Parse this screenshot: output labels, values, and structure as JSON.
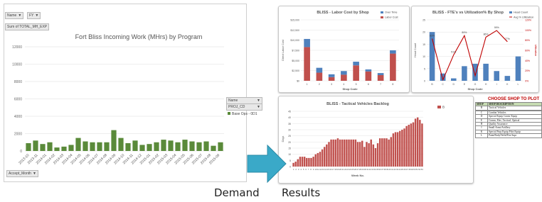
{
  "pivot": {
    "filters": [
      {
        "label": "Name",
        "icon": "filter-icon"
      },
      {
        "label": "FY",
        "icon": "dropdown-icon"
      }
    ],
    "measure_chip": "Sum of TOTAL_MH_EXP",
    "axis_button": "Accept_Month",
    "legend_field_name": "Name",
    "legend_field_value": "PROJ_CD",
    "legend_series": "Base Ops - 0D1",
    "colors": {
      "bar": "#5a8a3a",
      "grid": "#d9d9d9"
    }
  },
  "chart_data": [
    {
      "type": "bar",
      "title": "Fort Bliss Incoming Work (MHrs) by Program",
      "series": [
        {
          "name": "Base Ops - 0D1",
          "values": [
            900,
            1200,
            800,
            1000,
            400,
            500,
            700,
            1500,
            1100,
            1000,
            1000,
            1000,
            2400,
            1500,
            900,
            1200,
            700,
            800,
            1000,
            1300,
            1200,
            1000,
            1300,
            1100,
            1000,
            1100,
            600,
            1000
          ]
        }
      ],
      "x_tick_labels": [
        "2013-10",
        "2013-11",
        "2014-01",
        "2014-02",
        "2014-03",
        "2014-04",
        "2014-05",
        "2014-06",
        "2014-07",
        "2014-08",
        "2014-09",
        "2014-10",
        "2014-11",
        "2014-12",
        "2015-01",
        "2015-02",
        "2015-03",
        "2015-04",
        "2015-05",
        "2015-06",
        "2015-07",
        "2015-08",
        "2015-09"
      ],
      "y_ticks": [
        0,
        2000,
        4000,
        6000,
        8000,
        10000,
        12000
      ],
      "ylim": [
        0,
        12000
      ],
      "grid": true,
      "legend": "right"
    },
    {
      "type": "bar",
      "title": "BLISS - Labor Cost by Shop",
      "categories": [
        "1",
        "2",
        "3",
        "4",
        "5",
        "6",
        "7",
        "8"
      ],
      "series": [
        {
          "name": "Over Time",
          "values": [
            2000,
            1200,
            700,
            900,
            900,
            500,
            500,
            800
          ]
        },
        {
          "name": "Labor Cost",
          "values": [
            8300,
            2000,
            900,
            1500,
            3800,
            2300,
            1400,
            6700
          ]
        }
      ],
      "y_ticks": [
        "$0",
        "$2,500",
        "$5,000",
        "$7,500",
        "$10,000",
        "$12,500",
        "$15,000"
      ],
      "ylim": [
        0,
        15000
      ],
      "xlabel": "Shop Code",
      "ylabel": "Direct Labor Cost",
      "legend": "top-right",
      "colors": {
        "over_time": "#4f81bd",
        "labor_cost": "#c0504d"
      }
    },
    {
      "type": "bar+line",
      "title": "BLISS - FTE's vs Utilization% By Shop",
      "categories": [
        "B",
        "C",
        "D",
        "E",
        "G",
        "H",
        "I",
        "K",
        "L"
      ],
      "series": [
        {
          "name": "Head Count",
          "values": [
            20,
            3,
            1,
            6,
            7,
            7,
            4,
            2,
            10
          ]
        },
        {
          "name": "Avg % Utilization",
          "values": [
            83,
            2,
            51,
            89,
            10,
            86,
            99,
            77,
            null
          ]
        }
      ],
      "point_labels": [
        "83%",
        "",
        "51%",
        "89%",
        "",
        "86%",
        "99%",
        "77%"
      ],
      "y_ticks": [
        0,
        5,
        10,
        15,
        20,
        25
      ],
      "y2_ticks": [
        "0%",
        "20%",
        "40%",
        "60%",
        "80%",
        "100%",
        "120%"
      ],
      "ylim": [
        0,
        25
      ],
      "xlabel": "Shop Code",
      "ylabel": "Head Count",
      "y2label": "Utilization",
      "legend": "top-right",
      "colors": {
        "head_count": "#4f81bd",
        "utilization": "#c00000"
      }
    },
    {
      "type": "bar",
      "title": "BLISS - Tactical Vehicles Backlog",
      "series": [
        {
          "name": "B",
          "values": [
            3,
            4,
            6,
            8,
            8,
            8,
            7,
            7,
            7,
            8,
            10,
            11,
            12,
            14,
            16,
            18,
            20,
            22,
            22,
            22,
            23,
            22,
            22,
            22,
            22,
            22,
            22,
            22,
            22,
            20,
            20,
            21,
            16,
            20,
            19,
            22,
            18,
            15,
            19,
            23,
            23,
            23,
            23,
            22,
            24,
            27,
            28,
            28,
            29,
            30,
            31,
            33,
            34,
            35,
            36,
            39,
            40,
            38,
            35
          ]
        }
      ],
      "x_tick_labels": [
        "1",
        "2",
        "3",
        "4",
        "5",
        "6",
        "7",
        "8",
        "9",
        "10",
        "11",
        "12",
        "13",
        "14",
        "15",
        "16",
        "17",
        "18",
        "19",
        "20",
        "21",
        "22",
        "23",
        "24",
        "25",
        "26",
        "27",
        "28",
        "29",
        "30",
        "31",
        "32",
        "33",
        "34",
        "35",
        "36",
        "37",
        "38",
        "39",
        "40",
        "41",
        "42",
        "43",
        "44",
        "45",
        "46",
        "47",
        "48",
        "49",
        "50",
        "51",
        "52",
        "53"
      ],
      "y_ticks": [
        0,
        5,
        10,
        15,
        20,
        25,
        30,
        35,
        40,
        45
      ],
      "ylim": [
        0,
        45
      ],
      "xlabel": "Week No.",
      "ylabel": "Days",
      "legend": "right",
      "colors": {
        "bar": "#c0504d"
      }
    }
  ],
  "shop_table": {
    "title": "CHOOSE SHOP TO PLOT",
    "headers": [
      "SHOP",
      "SHOP DESCRIPTION"
    ],
    "rows": [
      [
        "B",
        "Tactical Vehicles"
      ],
      [
        "",
        ""
      ],
      [
        "C",
        "Combat Vehicles"
      ],
      [
        "D",
        "Special Equip Constr Equip"
      ],
      [
        "E",
        "Comm, Elec, Tactical, Optical"
      ],
      [
        "H",
        "Quality Assurance"
      ],
      [
        "I",
        "Small Arms/Artillery"
      ],
      [
        "K",
        "Special Purp Equip Pilot Equip"
      ],
      [
        "L",
        "Paint/Body/Weld/Fire Supr"
      ]
    ]
  },
  "flow": {
    "demand_label": "Demand",
    "results_label": "Results",
    "arrow_icon": "right-arrow-icon",
    "arrow_color": "#3aa9c8"
  }
}
